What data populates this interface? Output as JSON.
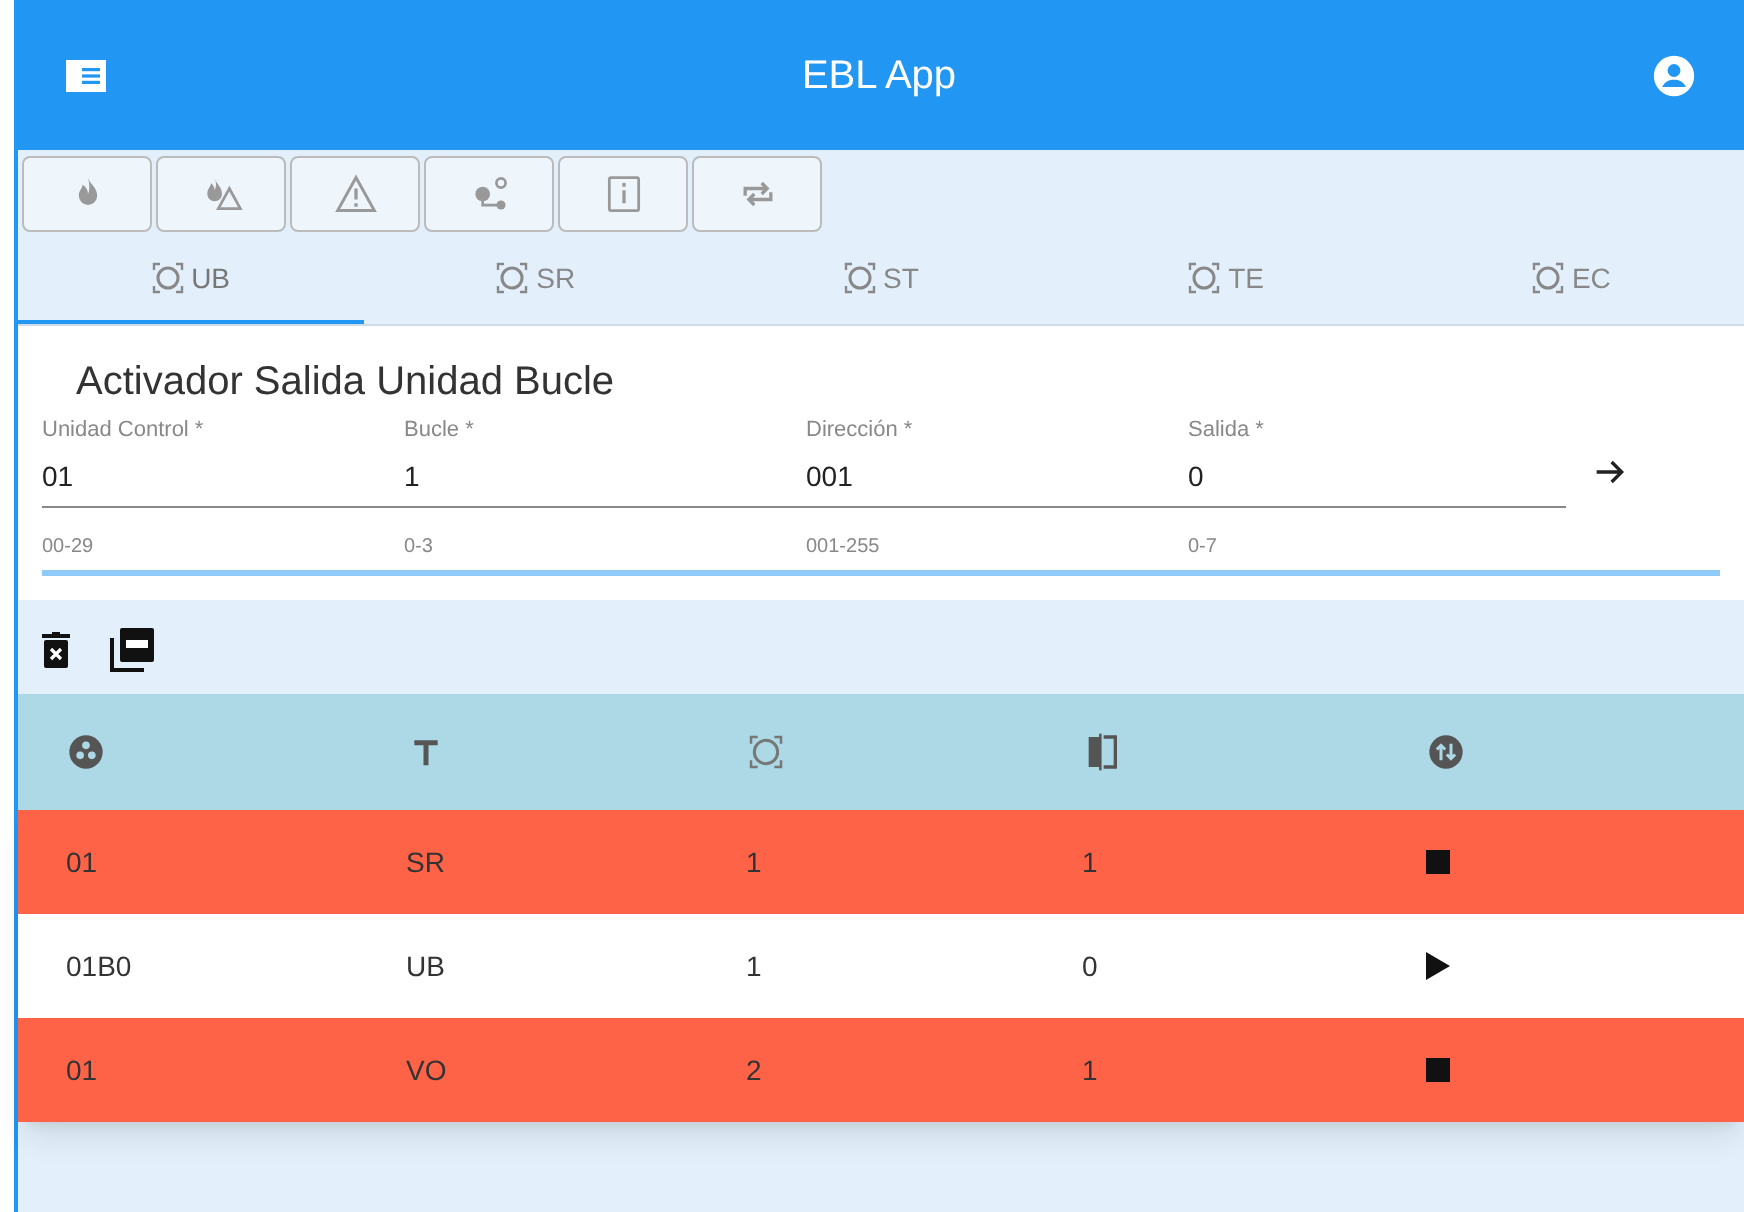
{
  "app_bar": {
    "title": "EBL App"
  },
  "toolbar_buttons": [
    {
      "kind": "fire"
    },
    {
      "kind": "fire-warning"
    },
    {
      "kind": "warning"
    },
    {
      "kind": "connection"
    },
    {
      "kind": "info"
    },
    {
      "kind": "repeat"
    }
  ],
  "tabs": [
    {
      "label": "UB",
      "selected": true
    },
    {
      "label": "SR",
      "selected": false
    },
    {
      "label": "ST",
      "selected": false
    },
    {
      "label": "TE",
      "selected": false
    },
    {
      "label": "EC",
      "selected": false
    }
  ],
  "form": {
    "title": "Activador Salida Unidad Bucle",
    "fields": [
      {
        "label": "Unidad Control *",
        "value": "01",
        "hint": "00-29"
      },
      {
        "label": "Bucle *",
        "value": "1",
        "hint": "0-3"
      },
      {
        "label": "Dirección *",
        "value": "001",
        "hint": "001-255"
      },
      {
        "label": "Salida *",
        "value": "0",
        "hint": "0-7"
      }
    ]
  },
  "table": {
    "columns": [
      {
        "kind": "group"
      },
      {
        "kind": "type"
      },
      {
        "kind": "device"
      },
      {
        "kind": "compare"
      },
      {
        "kind": "swap"
      }
    ],
    "rows": [
      {
        "cells": [
          "01",
          "SR",
          "1",
          "1"
        ],
        "active": true
      },
      {
        "cells": [
          "01B0",
          "UB",
          "1",
          "0"
        ],
        "active": false
      },
      {
        "cells": [
          "01",
          "VO",
          "2",
          "1"
        ],
        "active": true
      }
    ]
  }
}
